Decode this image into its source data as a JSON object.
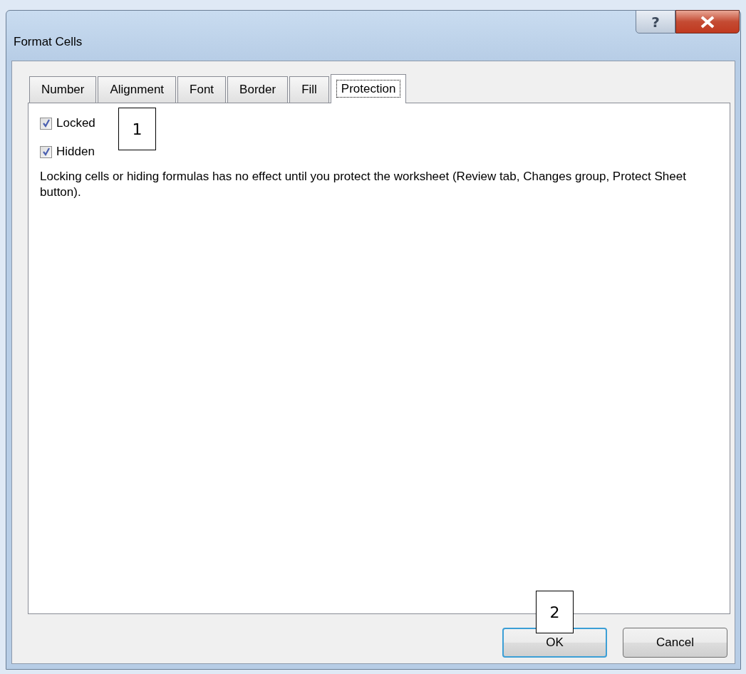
{
  "window": {
    "title": "Format Cells",
    "help_button": "?"
  },
  "tabs": [
    {
      "label": "Number",
      "selected": false
    },
    {
      "label": "Alignment",
      "selected": false
    },
    {
      "label": "Font",
      "selected": false
    },
    {
      "label": "Border",
      "selected": false
    },
    {
      "label": "Fill",
      "selected": false
    },
    {
      "label": "Protection",
      "selected": true
    }
  ],
  "options": [
    {
      "label": "Locked",
      "checked": true
    },
    {
      "label": "Hidden",
      "checked": true
    }
  ],
  "description": "Locking cells or hiding formulas has no effect until you protect the worksheet (Review tab, Changes group, Protect Sheet button).",
  "buttons": [
    {
      "label": "OK",
      "default": true
    },
    {
      "label": "Cancel",
      "default": false
    }
  ],
  "callouts": [
    "1",
    "2"
  ]
}
